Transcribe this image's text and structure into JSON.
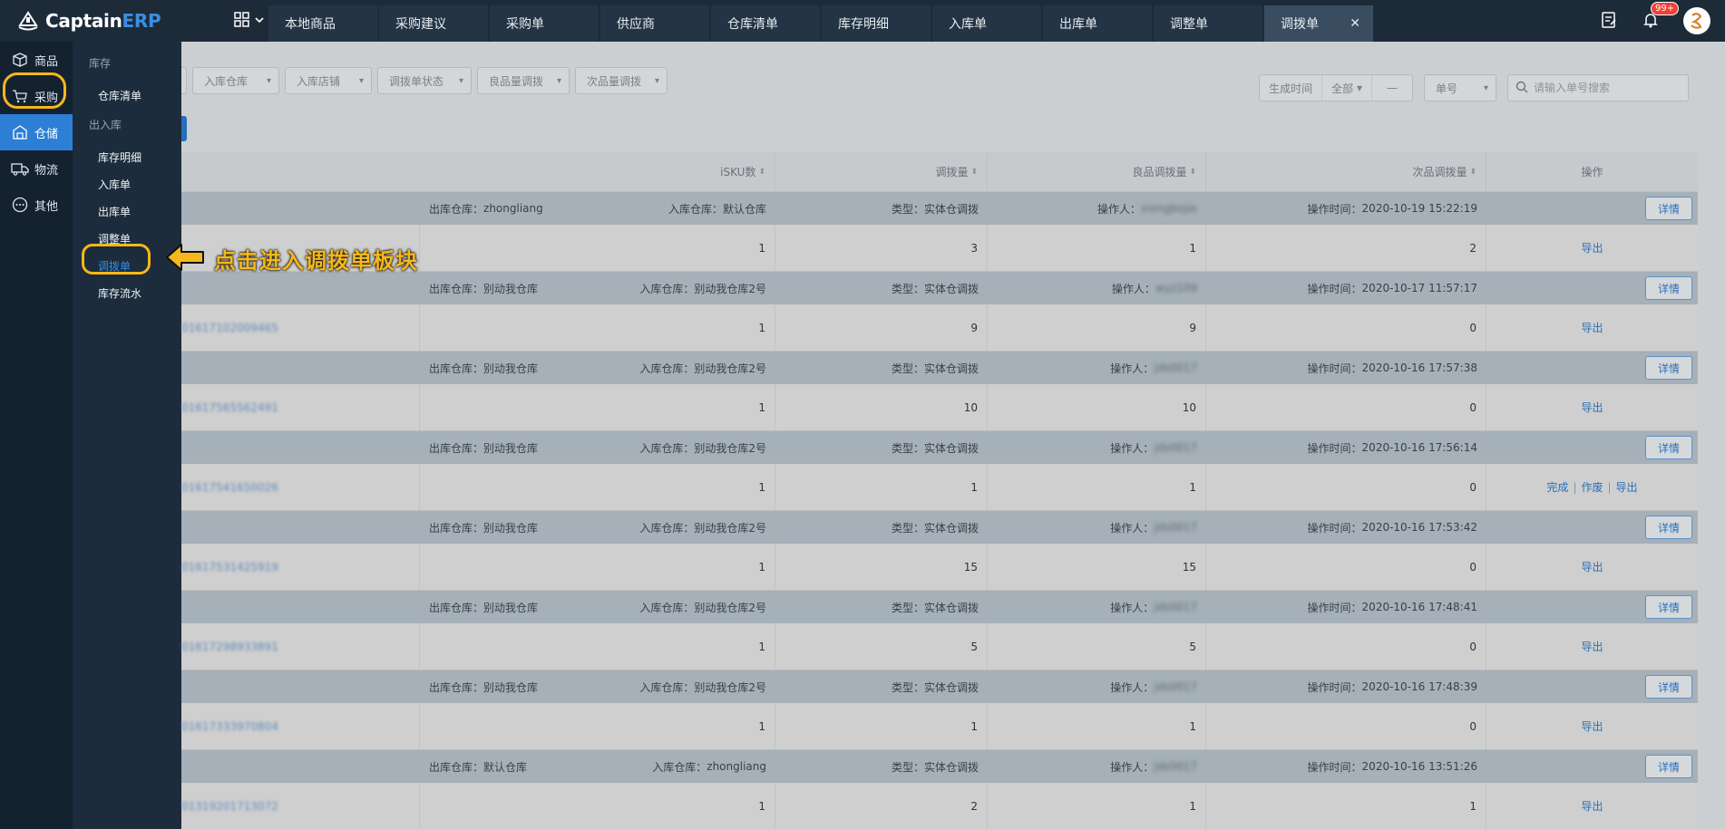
{
  "brand": {
    "name_main": "Captain",
    "name_accent": "ERP"
  },
  "tabs": [
    {
      "label": "本地商品"
    },
    {
      "label": "采购建议"
    },
    {
      "label": "采购单"
    },
    {
      "label": "供应商"
    },
    {
      "label": "仓库清单"
    },
    {
      "label": "库存明细"
    },
    {
      "label": "入库单"
    },
    {
      "label": "出库单"
    },
    {
      "label": "调整单"
    },
    {
      "label": "调拨单",
      "active": true
    }
  ],
  "notifications": {
    "badge": "99+"
  },
  "nav": [
    {
      "label": "商品",
      "icon": "box-icon"
    },
    {
      "label": "采购",
      "icon": "cart-icon"
    },
    {
      "label": "仓储",
      "icon": "warehouse-icon",
      "active": true
    },
    {
      "label": "物流",
      "icon": "truck-icon"
    },
    {
      "label": "其他",
      "icon": "more-icon"
    }
  ],
  "subnav": {
    "group1": "库存",
    "group1_items": [
      "仓库清单"
    ],
    "group2": "出入库",
    "group2_items": [
      "库存明细",
      "入库单",
      "出库单",
      "调整单",
      "调拨单",
      "库存流水"
    ]
  },
  "callout": {
    "text": "点击进入调拨单板块"
  },
  "filters": {
    "items": [
      "入库仓库",
      "入库店铺",
      "调拨单状态",
      "良品量调拨",
      "次品量调拨"
    ],
    "date_label": "生成时间",
    "date_range": "全部",
    "date_sep": "—",
    "field_select": "单号",
    "search_placeholder": "请输入单号搜索"
  },
  "table": {
    "headers": {
      "sku_count": "iSKU数",
      "transfer_qty": "调拨量",
      "good_qty": "良品调拨量",
      "bad_qty": "次品调拨量",
      "ops": "操作"
    },
    "labels": {
      "out_wh": "出库仓库：",
      "in_wh": "入库仓库：",
      "type": "类型：",
      "operator": "操作人：",
      "op_time": "操作时间：",
      "detail": "详情",
      "export": "导出",
      "complete": "完成",
      "void": "作废"
    },
    "rows": [
      {
        "out_wh": "zhongliang",
        "in_wh": "默认仓库",
        "type": "实体仓调拨",
        "operator": "xiongbojie",
        "op_time": "2020-10-19 15:22:19",
        "order_no": "",
        "sku": "1",
        "qty": "3",
        "good": "1",
        "bad": "2",
        "ops": [
          "导出"
        ]
      },
      {
        "out_wh": "别动我仓库",
        "in_wh": "别动我仓库2号",
        "type": "实体仓调拨",
        "operator": "wyz109",
        "op_time": "2020-10-17 11:57:17",
        "order_no": "01617102009465",
        "sku": "1",
        "qty": "9",
        "good": "9",
        "bad": "0",
        "ops": [
          "导出"
        ]
      },
      {
        "out_wh": "别动我仓库",
        "in_wh": "别动我仓库2号",
        "type": "实体仓调拨",
        "operator": "jds0017",
        "op_time": "2020-10-16 17:57:38",
        "order_no": "01617565562491",
        "sku": "1",
        "qty": "10",
        "good": "10",
        "bad": "0",
        "ops": [
          "导出"
        ]
      },
      {
        "out_wh": "别动我仓库",
        "in_wh": "别动我仓库2号",
        "type": "实体仓调拨",
        "operator": "jds0017",
        "op_time": "2020-10-16 17:56:14",
        "order_no": "01617541650026",
        "sku": "1",
        "qty": "1",
        "good": "1",
        "bad": "0",
        "ops": [
          "完成",
          "作废",
          "导出"
        ]
      },
      {
        "out_wh": "别动我仓库",
        "in_wh": "别动我仓库2号",
        "type": "实体仓调拨",
        "operator": "jds0017",
        "op_time": "2020-10-16 17:53:42",
        "order_no": "01617531425919",
        "sku": "1",
        "qty": "15",
        "good": "15",
        "bad": "0",
        "ops": [
          "导出"
        ]
      },
      {
        "out_wh": "别动我仓库",
        "in_wh": "别动我仓库2号",
        "type": "实体仓调拨",
        "operator": "jds0017",
        "op_time": "2020-10-16 17:48:41",
        "order_no": "01617298933891",
        "sku": "1",
        "qty": "5",
        "good": "5",
        "bad": "0",
        "ops": [
          "导出"
        ]
      },
      {
        "out_wh": "别动我仓库",
        "in_wh": "别动我仓库2号",
        "type": "实体仓调拨",
        "operator": "jds0017",
        "op_time": "2020-10-16 17:48:39",
        "order_no": "01617333970804",
        "sku": "1",
        "qty": "1",
        "good": "1",
        "bad": "0",
        "ops": [
          "导出"
        ]
      },
      {
        "out_wh": "默认仓库",
        "in_wh": "zhongliang",
        "type": "实体仓调拨",
        "operator": "jds0017",
        "op_time": "2020-10-16 13:51:26",
        "order_no": "01319201713072",
        "sku": "1",
        "qty": "2",
        "good": "1",
        "bad": "1",
        "ops": [
          "导出"
        ]
      }
    ]
  },
  "colors": {
    "accent": "#2d7fd6",
    "highlight": "#f5b81a",
    "topbar": "#1d2b39"
  }
}
